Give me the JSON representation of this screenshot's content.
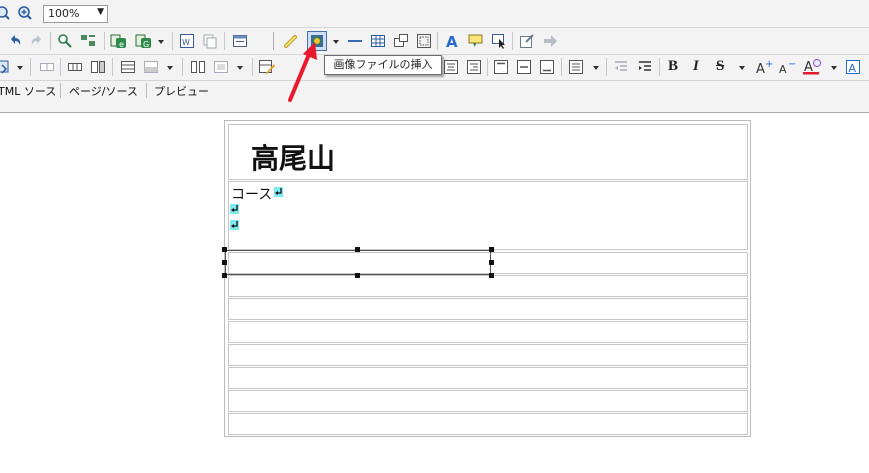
{
  "toolbar": {
    "zoom_value": "100%",
    "tooltip": "画像ファイルの挿入",
    "format_bold": "B",
    "format_italic": "I",
    "format_strike": "S"
  },
  "tabs": [
    {
      "label": "TML ソース"
    },
    {
      "label": "ページ/ソース"
    },
    {
      "label": "プレビュー"
    }
  ],
  "page": {
    "title": "高尾山",
    "course_label": "コース"
  },
  "colors": {
    "arrow": "#e8192c",
    "pilcrow_bg": "#7fe8f0"
  }
}
